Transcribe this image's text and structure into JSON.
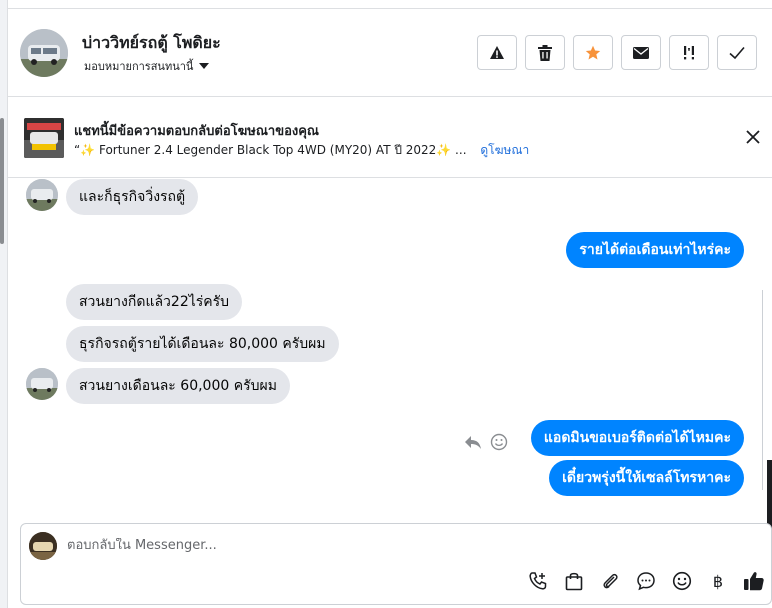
{
  "header": {
    "name": "บ่าววิทย์รถตู้ โพดิยะ",
    "assign_label": "มอบหมายการสนทนานี้"
  },
  "ad": {
    "title": "แชทนี้มีข้อความตอบกลับต่อโฆษณาของคุณ",
    "subtitle": "“✨ Fortuner 2.4 Legender Black Top 4WD (MY20) AT ปี 2022✨ ...",
    "link": "ดูโฆษณา"
  },
  "messages": [
    {
      "direction": "in",
      "text": "และก็ธุรกิจวิ่งรถตู้"
    },
    {
      "direction": "out",
      "text": "รายได้ต่อเดือนเท่าไหร่คะ"
    },
    {
      "direction": "in",
      "text": "สวนยางกีดแล้ว22ไร่ครับ"
    },
    {
      "direction": "in",
      "text": "ธุรกิจรถตู้รายได้เดือนละ 80,000 ครับผม"
    },
    {
      "direction": "in",
      "text": "สวนยางเดือนละ 60,000 ครับผม"
    },
    {
      "direction": "out",
      "text": "แอดมินขอเบอร์ติดต่อได้ไหมคะ"
    },
    {
      "direction": "out",
      "text": "เดี๋ยวพรุ่งนี้ให้เซลล์โทรหาคะ"
    }
  ],
  "composer": {
    "placeholder": "ตอบกลับใน Messenger...",
    "baht_symbol": "฿"
  },
  "colors": {
    "outgoing_bubble": "#0084ff",
    "incoming_bubble": "#e4e6eb",
    "star_accent": "#f7923a",
    "link": "#216fdb"
  },
  "icons": {
    "header_actions": [
      "warning-icon",
      "trash-icon",
      "star-icon",
      "envelope-icon",
      "follow-up-icon",
      "check-icon"
    ],
    "composer_tools": [
      "phone-plus-icon",
      "bag-icon",
      "paperclip-icon",
      "chat-bubble-icon",
      "emoji-icon",
      "baht-icon",
      "thumbs-up-icon"
    ]
  }
}
